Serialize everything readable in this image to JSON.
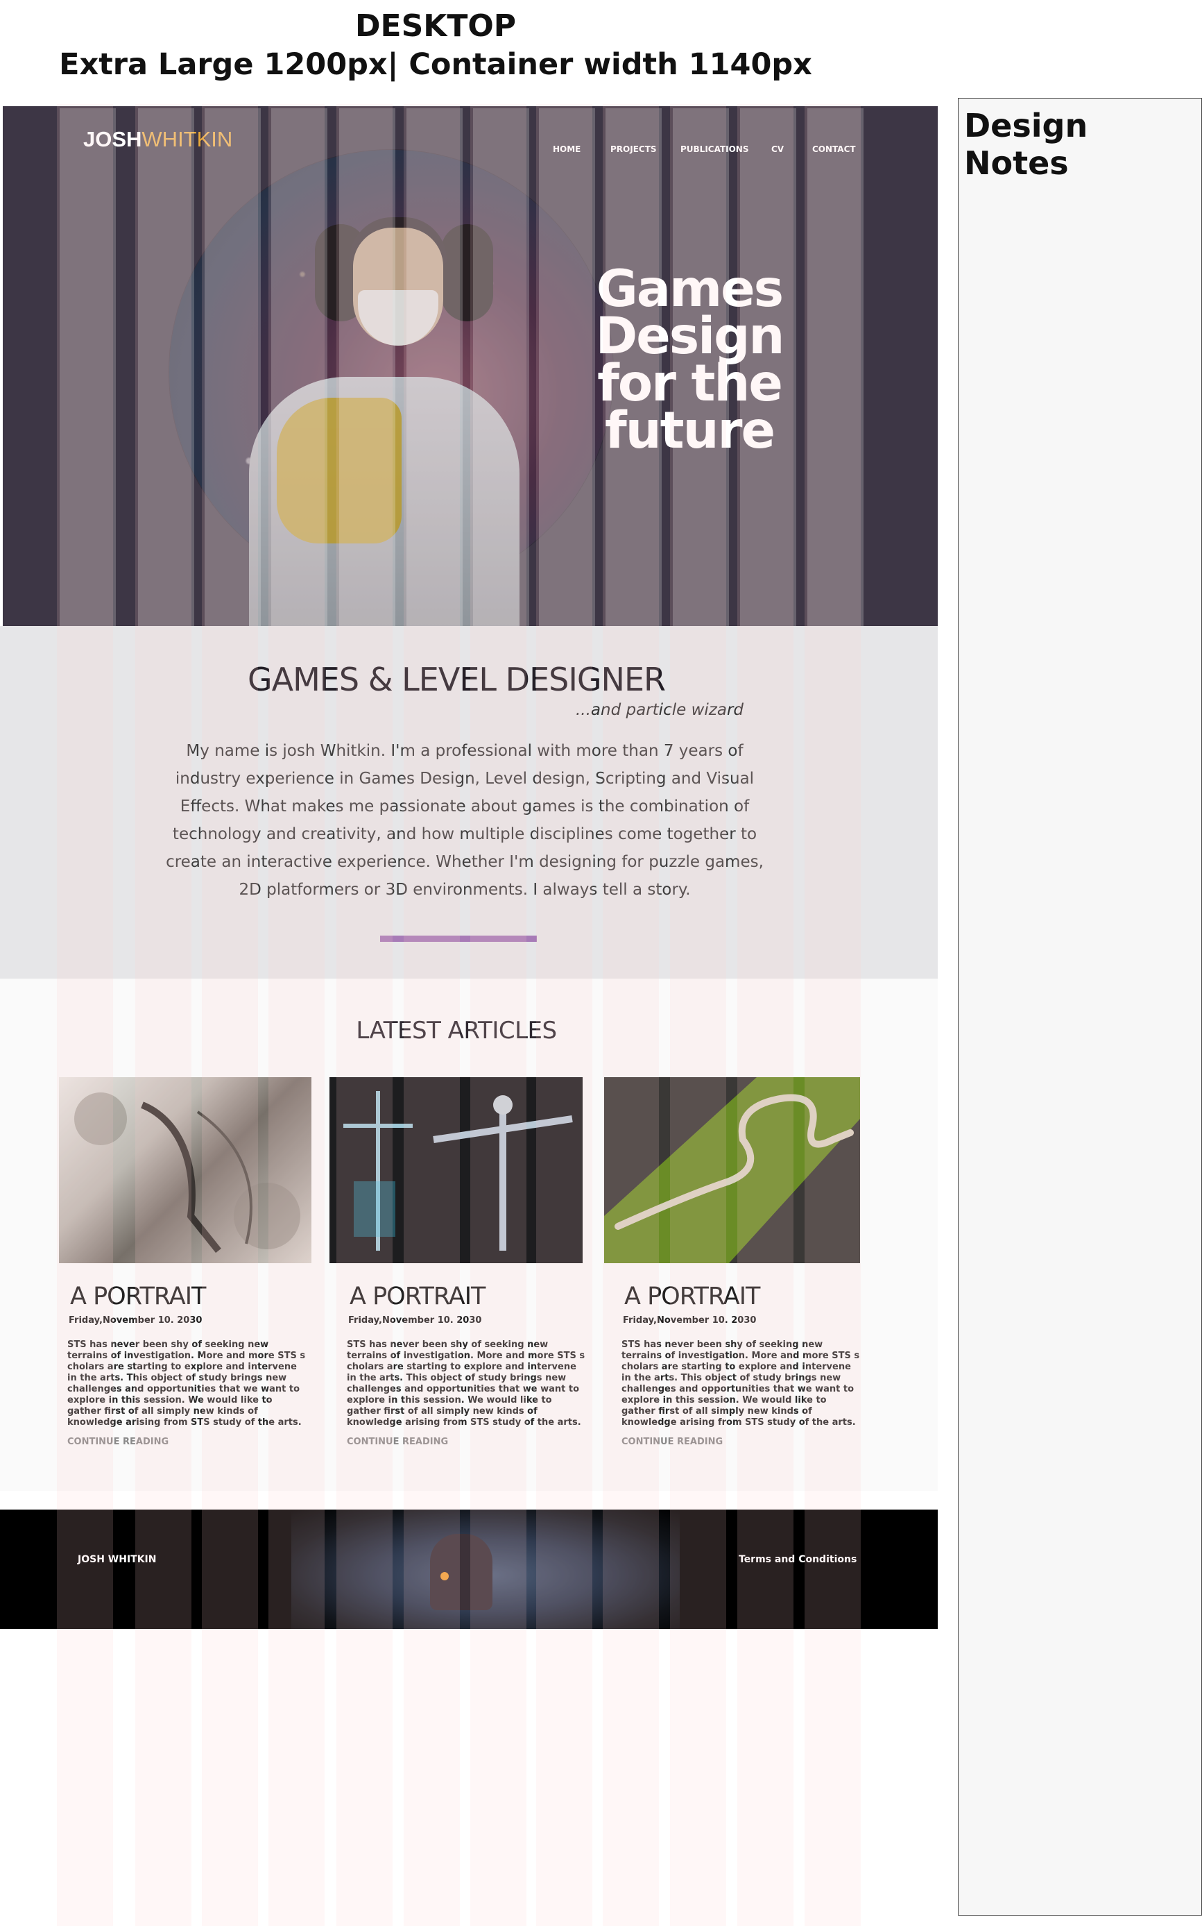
{
  "captions": {
    "line1": "DESKTOP",
    "line2": "Extra Large 1200px| Container width 1140px"
  },
  "header": {
    "brand_first": "JOSH",
    "brand_second": "WHITKIN",
    "nav": [
      "HOME",
      "PROJECTS",
      "PUBLICATIONS",
      "CV",
      "CONTACT"
    ]
  },
  "hero": {
    "title_lines": [
      "Games",
      "Design",
      "for the",
      "future"
    ]
  },
  "intro": {
    "title": "GAMES & LEVEL DESIGNER",
    "subtitle": "...and particle wizard",
    "body": "My  name is josh Whitkin. I'm a professional with more than 7 years of industry experience in Games Design, Level design, Scripting and Visual Effects.  What makes me passionate about games is the combination of technology  and creativity, and how multiple disciplines come together to create an interactive experience. Whether I'm designing for puzzle games, 2D platformers or 3D environments. I always tell a story."
  },
  "articles": {
    "title": "LATEST ARTICLES",
    "cards": [
      {
        "title": "A PORTRAIT",
        "date": "Friday,November 10. 2030",
        "body": "STS has never been shy of seeking new terrains of investigation. More and  more  STS s cholars are starting to explore and intervene in the arts.  This object of study  brings  new challenges and opportunities that we want  to explore in this session.   We would  like to gather first of all simply new kinds of  knowledge arising from  STS study of the arts.",
        "more": "CONTINUE READING"
      },
      {
        "title": "A PORTRAIT",
        "date": "Friday,November 10. 2030",
        "body": "STS has never been shy of seeking new terrains of investigation. More and  more  STS s cholars are starting to explore and intervene in the arts.  This object of study  brings  new challenges and opportunities that we want  to explore in this session.   We would  like to gather first of all simply new kinds of  knowledge arising from  STS study of the arts.",
        "more": "CONTINUE READING"
      },
      {
        "title": "A PORTRAIT",
        "date": "Friday,November 10. 2030",
        "body": "STS has never been shy of seeking new terrains of investigation. More and  more  STS s cholars are starting to explore and intervene in the arts.  This object of study  brings  new challenges and opportunities that we want  to explore in this session.   We would  like to gather first of all simply new kinds of  knowledge arising from  STS study of the arts.",
        "more": "CONTINUE READING"
      }
    ]
  },
  "footer": {
    "brand": "JOSH WHITKIN",
    "link": "Terms and Conditions"
  },
  "notes": {
    "title": "Design Notes"
  },
  "colors": {
    "hero_bg": "#3d3645",
    "brand_accent": "#e8a93a",
    "intro_bg": "#e6e6e8",
    "divider": "#a77bb7",
    "footer_bg": "#000000"
  }
}
